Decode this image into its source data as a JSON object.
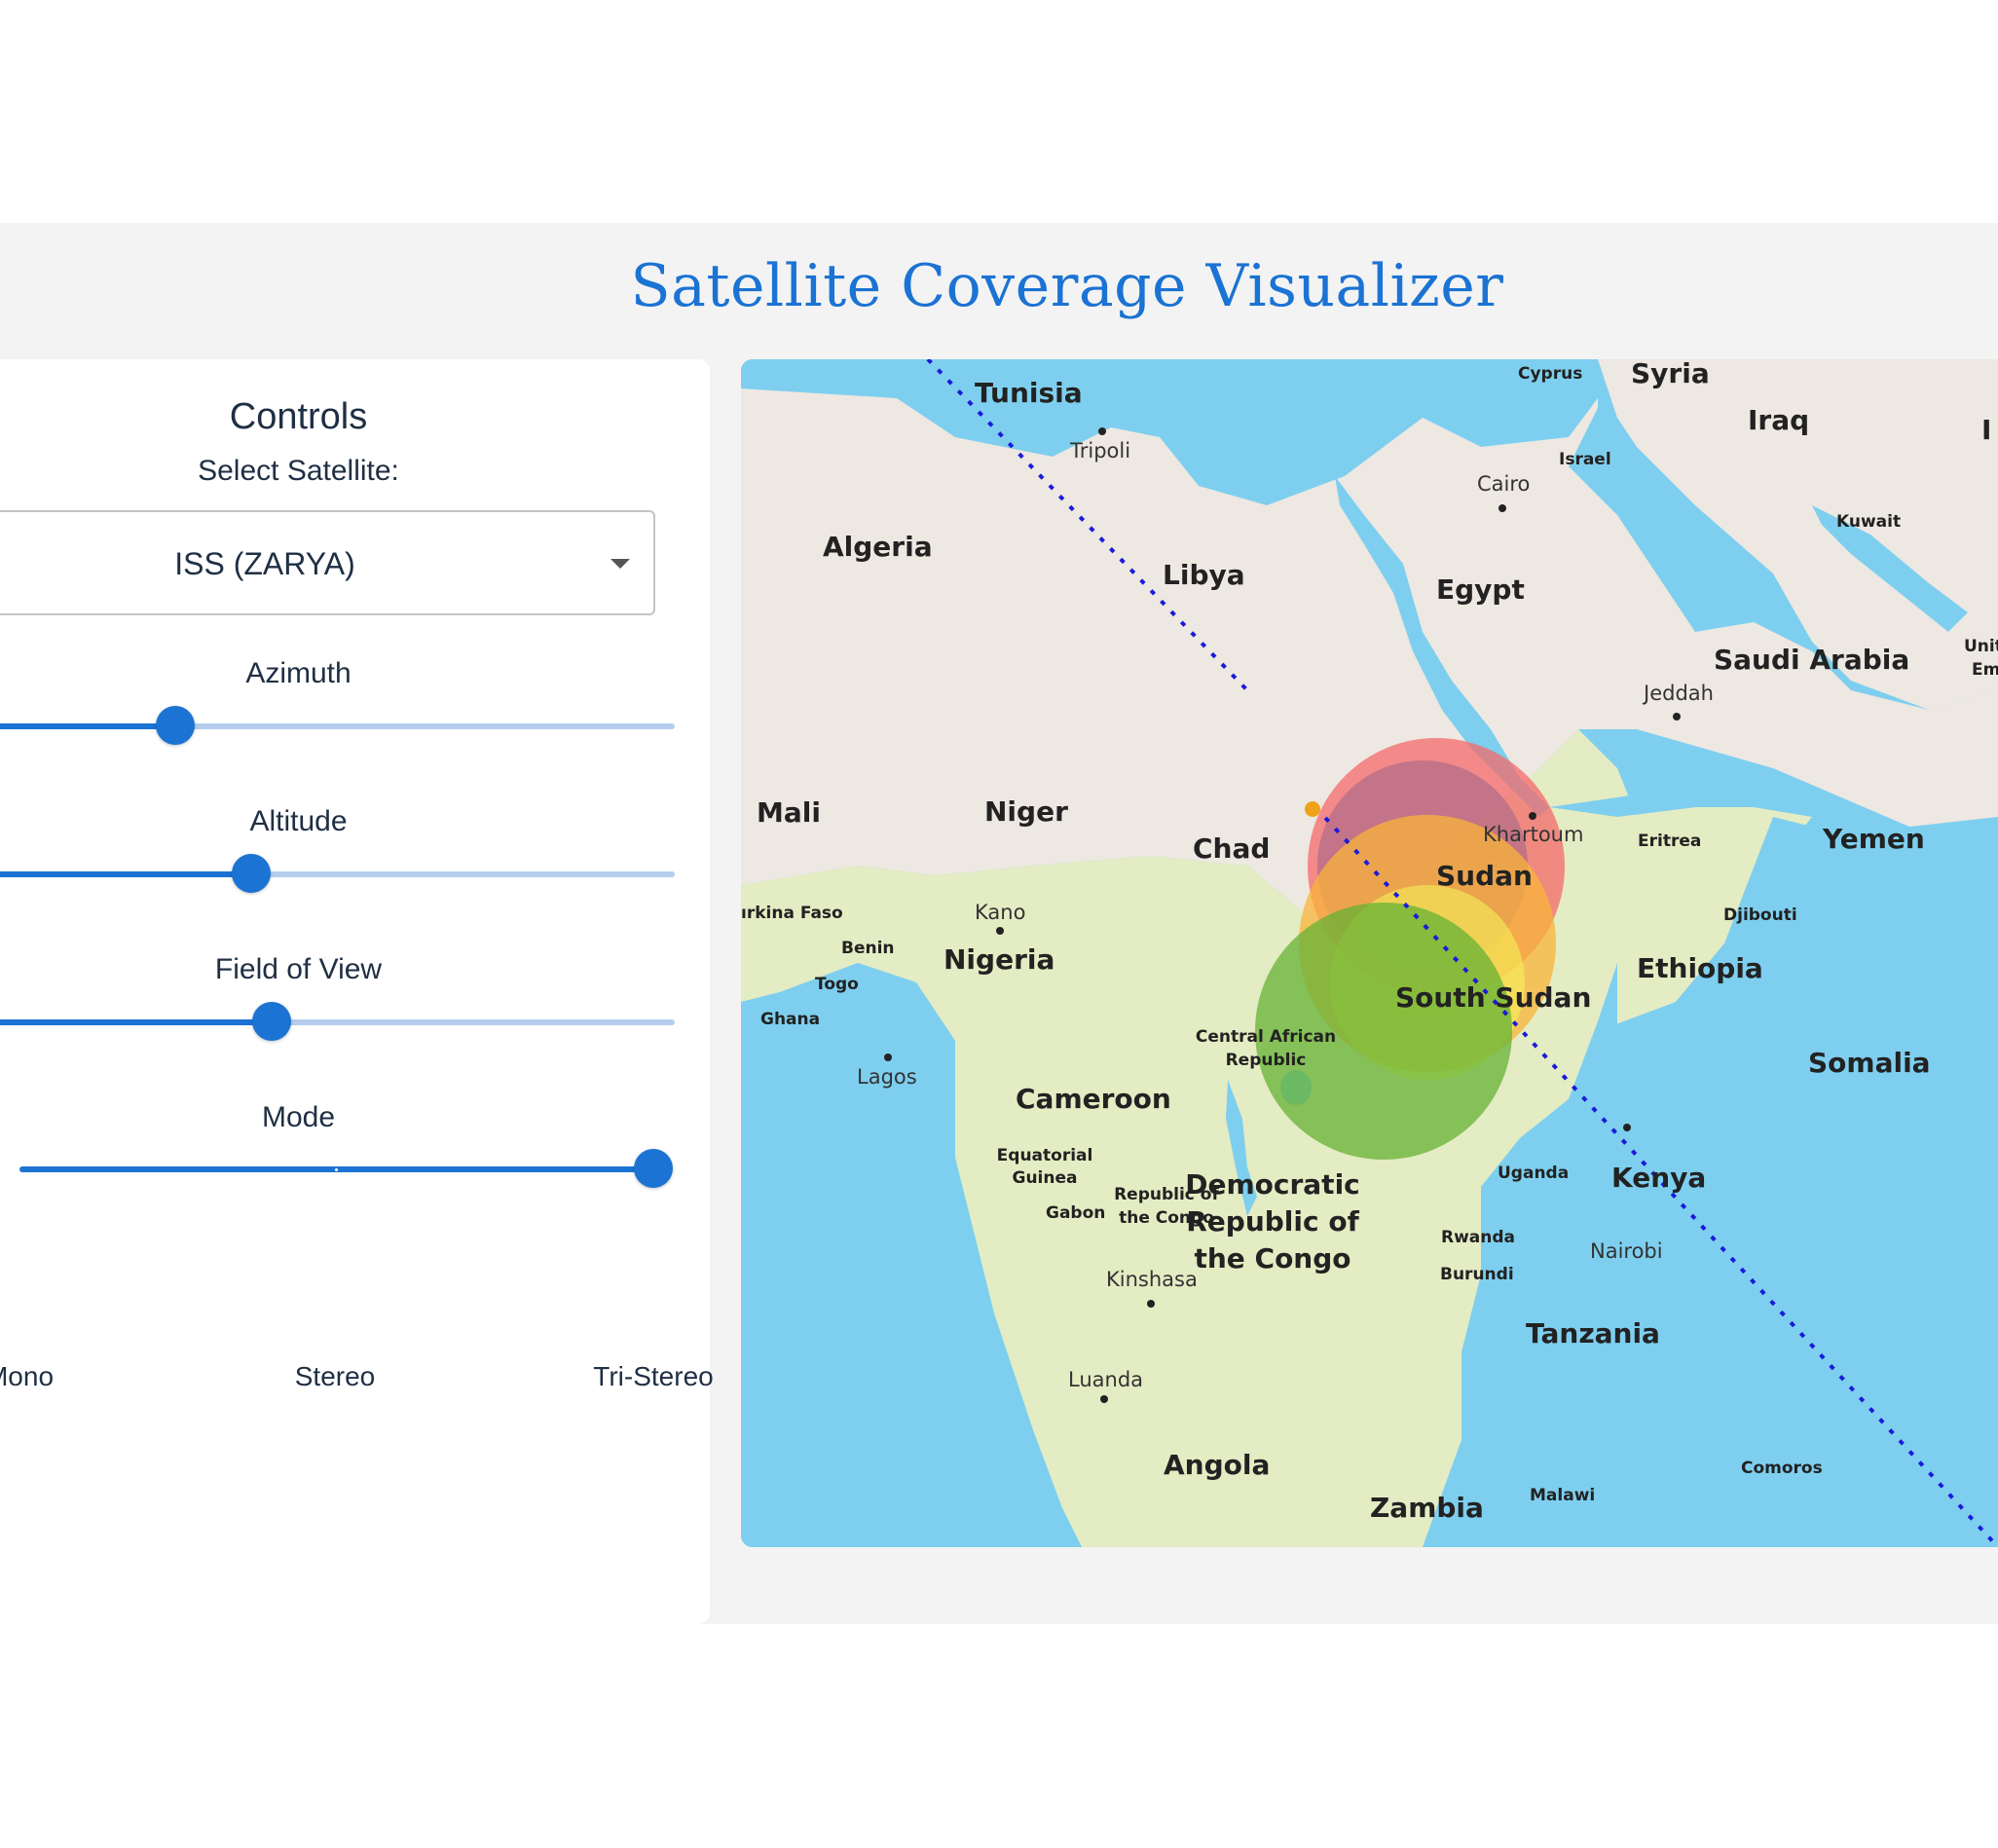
{
  "page": {
    "title": "Satellite Coverage Visualizer"
  },
  "controls": {
    "title": "Controls",
    "select_label": "Select Satellite:",
    "selected_satellite": "ISS (ZARYA)",
    "sliders": {
      "azimuth": {
        "label": "Azimuth",
        "fraction": 0.28
      },
      "altitude": {
        "label": "Altitude",
        "fraction": 0.39
      },
      "fov": {
        "label": "Field of View",
        "fraction": 0.42
      }
    },
    "mode": {
      "label": "Mode",
      "options": [
        "Mono",
        "Stereo",
        "Tri-Stereo"
      ],
      "selected": "Tri-Stereo"
    }
  },
  "map": {
    "colors": {
      "water": "#7ecfef",
      "land_desert": "#eee8e2",
      "land_green": "#e4ecc3",
      "ground_track": "#1a1adb",
      "coverage_red": "#f46a6a",
      "coverage_orange": "#f8b43a",
      "coverage_yellow": "#f4f55a",
      "coverage_green": "#65b234",
      "satellite_marker": "#f0a21a"
    },
    "countries": {
      "tunisia": "Tunisia",
      "syria": "Syria",
      "iraq": "Iraq",
      "algeria": "Algeria",
      "libya": "Libya",
      "egypt": "Egypt",
      "saudi_arabia": "Saudi Arabia",
      "mali": "Mali",
      "niger": "Niger",
      "chad": "Chad",
      "sudan": "Sudan",
      "yemen": "Yemen",
      "nigeria": "Nigeria",
      "ethiopia": "Ethiopia",
      "south_sudan": "South Sudan",
      "somalia": "Somalia",
      "cameroon": "Cameroon",
      "kenya": "Kenya",
      "drc_line1": "Democratic",
      "drc_line2": "Republic of",
      "drc_line3": "the Congo",
      "tanzania": "Tanzania",
      "angola": "Angola",
      "zambia": "Zambia"
    },
    "small_labels": {
      "cyprus": "Cyprus",
      "israel": "Israel",
      "kuwait": "Kuwait",
      "uae_line1": "Unit",
      "uae_line2": "Em",
      "eritrea": "Eritrea",
      "djibouti": "Djibouti",
      "burkina_faso": "ırkina Faso",
      "benin": "Benin",
      "togo": "Togo",
      "ghana": "Ghana",
      "car_line1": "Central African",
      "car_line2": "Republic",
      "eq_guinea_line1": "Equatorial",
      "eq_guinea_line2": "Guinea",
      "gabon": "Gabon",
      "roc_line1": "Republic of",
      "roc_line2": "the Congo",
      "uganda": "Uganda",
      "rwanda": "Rwanda",
      "burundi": "Burundi",
      "comoros": "Comoros",
      "malawi": "Malawi",
      "iran_partial": "I"
    },
    "cities": {
      "tripoli": "Tripoli",
      "cairo": "Cairo",
      "jeddah": "Jeddah",
      "khartoum": "Khartoum",
      "kano": "Kano",
      "lagos": "Lagos",
      "nairobi": "Nairobi",
      "kinshasa": "Kinshasa",
      "luanda": "Luanda"
    }
  }
}
